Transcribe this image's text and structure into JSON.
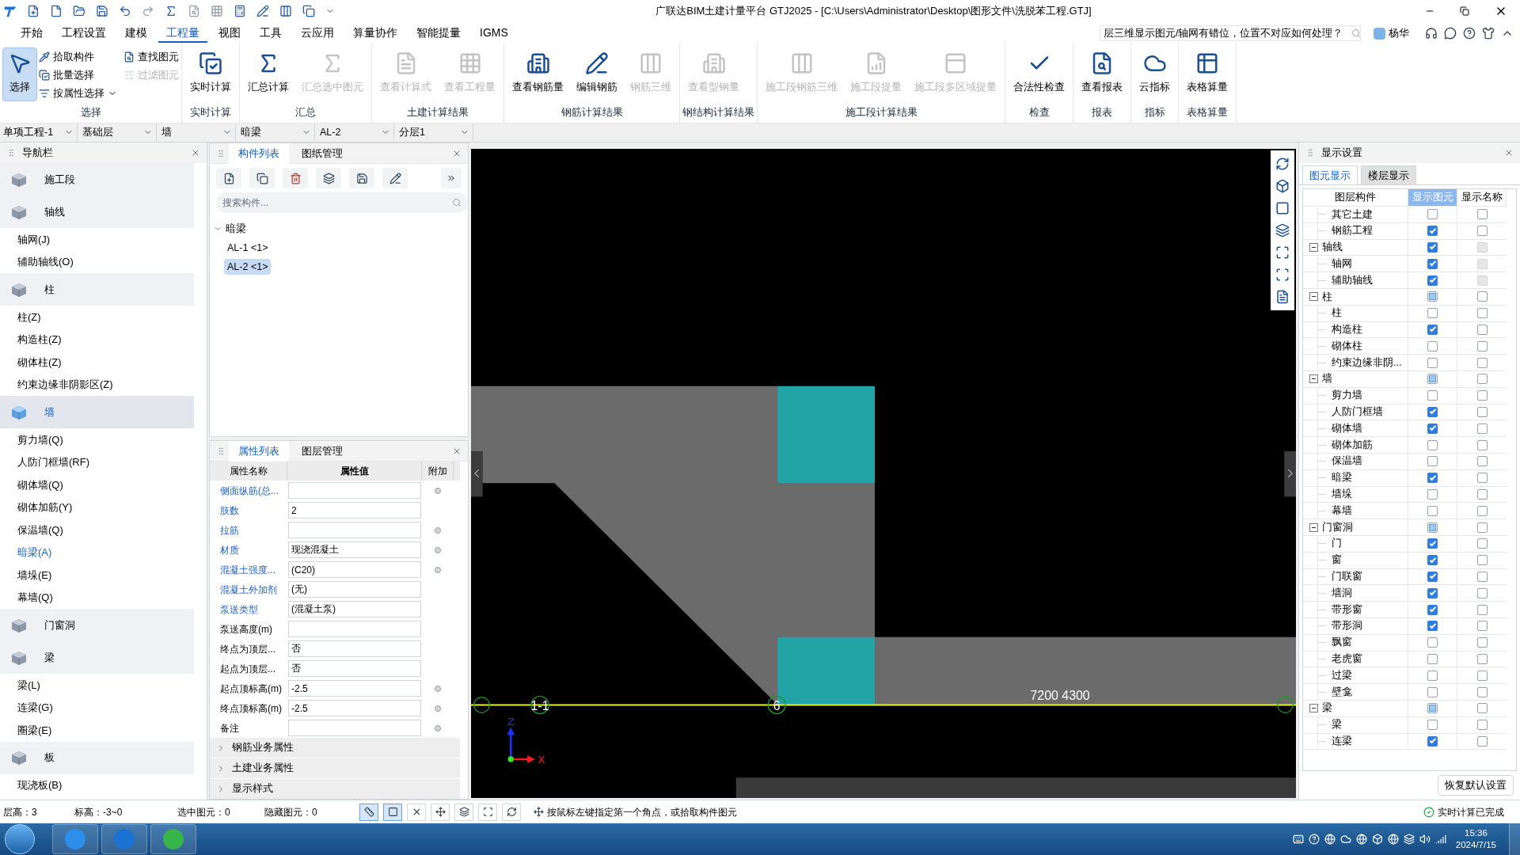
{
  "window": {
    "title": "广联达BIM土建计量平台 GTJ2025 - [C:\\Users\\Administrator\\Desktop\\图形文件\\洗脱苯工程.GTJ]"
  },
  "menu": [
    {
      "label": "开始",
      "selected": false
    },
    {
      "label": "工程设置",
      "selected": false
    },
    {
      "label": "建模",
      "selected": false
    },
    {
      "label": "工程量",
      "selected": true
    },
    {
      "label": "视图",
      "selected": false
    },
    {
      "label": "工具",
      "selected": false
    },
    {
      "label": "云应用",
      "selected": false
    },
    {
      "label": "算量协作",
      "selected": false
    },
    {
      "label": "智能提量",
      "selected": false
    },
    {
      "label": "IGMS",
      "selected": false
    }
  ],
  "help_search": {
    "value": "层三维显示图元/轴网有错位，位置不对应如何处理？"
  },
  "user": {
    "name": "杨华"
  },
  "ribbon": [
    {
      "label": "选择",
      "buttons": [
        {
          "label": "选择",
          "disabled": false,
          "pressed": true
        }
      ],
      "small_buttons": [
        {
          "label": "拾取构件",
          "disabled": false,
          "menu": false
        },
        {
          "label": "批量选择",
          "disabled": false,
          "menu": false
        },
        {
          "label": "按属性选择",
          "disabled": false,
          "menu": true
        },
        {
          "label": "查找图元",
          "disabled": false,
          "menu": false
        },
        {
          "label": "过滤图元",
          "disabled": true,
          "menu": false
        }
      ]
    },
    {
      "label": "实时计算",
      "buttons": [
        {
          "label": "实时计算",
          "disabled": false,
          "pressed": false
        }
      ]
    },
    {
      "label": "汇总",
      "buttons": [
        {
          "label": "汇总计算",
          "disabled": false,
          "pressed": false
        },
        {
          "label": "汇总选中图元",
          "disabled": true,
          "pressed": false
        }
      ]
    },
    {
      "label": "土建计算结果",
      "buttons": [
        {
          "label": "查看计算式",
          "disabled": true,
          "pressed": false
        },
        {
          "label": "查看工程量",
          "disabled": true,
          "pressed": false
        }
      ]
    },
    {
      "label": "钢筋计算结果",
      "buttons": [
        {
          "label": "查看钢筋量",
          "disabled": false,
          "pressed": false
        },
        {
          "label": "编辑钢筋",
          "disabled": false,
          "pressed": false
        },
        {
          "label": "钢筋三维",
          "disabled": true,
          "pressed": false
        }
      ]
    },
    {
      "label": "钢结构计算结果",
      "buttons": [
        {
          "label": "查看型钢量",
          "disabled": true,
          "pressed": false
        }
      ]
    },
    {
      "label": "施工段计算结果",
      "buttons": [
        {
          "label": "施工段钢筋三维",
          "disabled": true,
          "pressed": false
        },
        {
          "label": "施工段提量",
          "disabled": true,
          "pressed": false
        },
        {
          "label": "施工段多区域提量",
          "disabled": true,
          "pressed": false
        }
      ]
    },
    {
      "label": "检查",
      "buttons": [
        {
          "label": "合法性检查",
          "disabled": false,
          "pressed": false
        }
      ]
    },
    {
      "label": "报表",
      "buttons": [
        {
          "label": "查看报表",
          "disabled": false,
          "pressed": false
        }
      ]
    },
    {
      "label": "指标",
      "buttons": [
        {
          "label": "云指标",
          "disabled": false,
          "pressed": false
        }
      ]
    },
    {
      "label": "表格算量",
      "buttons": [
        {
          "label": "表格算量",
          "disabled": false,
          "pressed": false
        }
      ]
    }
  ],
  "selectors": [
    "单项工程-1",
    "基础层",
    "墙",
    "暗梁",
    "AL-2",
    "分层1"
  ],
  "navigation": {
    "title": "导航栏",
    "items": [
      {
        "kind": "category",
        "label": "施工段",
        "selected": false
      },
      {
        "kind": "category",
        "label": "轴线",
        "selected": false
      },
      {
        "kind": "item",
        "label": "轴网(J)",
        "selected": false
      },
      {
        "kind": "item",
        "label": "辅助轴线(O)",
        "selected": false
      },
      {
        "kind": "category",
        "label": "柱",
        "selected": false
      },
      {
        "kind": "item",
        "label": "柱(Z)",
        "selected": false
      },
      {
        "kind": "item",
        "label": "构造柱(Z)",
        "selected": false
      },
      {
        "kind": "item",
        "label": "砌体柱(Z)",
        "selected": false
      },
      {
        "kind": "item",
        "label": "约束边缘非阴影区(Z)",
        "selected": false
      },
      {
        "kind": "category",
        "label": "墙",
        "selected": true
      },
      {
        "kind": "item",
        "label": "剪力墙(Q)",
        "selected": false
      },
      {
        "kind": "item",
        "label": "人防门框墙(RF)",
        "selected": false
      },
      {
        "kind": "item",
        "label": "砌体墙(Q)",
        "selected": false
      },
      {
        "kind": "item",
        "label": "砌体加筋(Y)",
        "selected": false
      },
      {
        "kind": "item",
        "label": "保温墙(Q)",
        "selected": false
      },
      {
        "kind": "item",
        "label": "暗梁(A)",
        "selected": true
      },
      {
        "kind": "item",
        "label": "墙垛(E)",
        "selected": false
      },
      {
        "kind": "item",
        "label": "幕墙(Q)",
        "selected": false
      },
      {
        "kind": "category",
        "label": "门窗洞",
        "selected": false
      },
      {
        "kind": "category",
        "label": "梁",
        "selected": false
      },
      {
        "kind": "item",
        "label": "梁(L)",
        "selected": false
      },
      {
        "kind": "item",
        "label": "连梁(G)",
        "selected": false
      },
      {
        "kind": "item",
        "label": "圈梁(E)",
        "selected": false
      },
      {
        "kind": "category",
        "label": "板",
        "selected": false
      },
      {
        "kind": "item",
        "label": "现浇板(B)",
        "selected": false
      }
    ]
  },
  "component_panel": {
    "tabs": [
      {
        "label": "构件列表",
        "selected": true
      },
      {
        "label": "图纸管理",
        "selected": false
      }
    ],
    "search": {
      "placeholder": "搜索构件..."
    },
    "tree": [
      {
        "label": "暗梁",
        "expanded": true,
        "children": [
          {
            "label": "AL-1 <1>",
            "selected": false
          },
          {
            "label": "AL-2 <1>",
            "selected": true
          }
        ]
      }
    ]
  },
  "property_panel": {
    "tabs": [
      {
        "label": "属性列表",
        "selected": true
      },
      {
        "label": "图层管理",
        "selected": false
      }
    ],
    "columns": [
      "属性名称",
      "属性值",
      "附加"
    ],
    "rows": [
      {
        "name": "侧面纵筋(总...",
        "value": "",
        "public": true,
        "extra": true
      },
      {
        "name": "肢数",
        "value": "2",
        "public": true,
        "extra": false
      },
      {
        "name": "拉筋",
        "value": "",
        "public": true,
        "extra": true
      },
      {
        "name": "材质",
        "value": "现浇混凝土",
        "public": true,
        "extra": true
      },
      {
        "name": "混凝土强度...",
        "value": "(C20)",
        "public": true,
        "extra": true
      },
      {
        "name": "混凝土外加剂",
        "value": "(无)",
        "public": true,
        "extra": false
      },
      {
        "name": "泵送类型",
        "value": "(混凝土泵)",
        "public": true,
        "extra": false
      },
      {
        "name": "泵送高度(m)",
        "value": "",
        "public": false,
        "extra": false
      },
      {
        "name": "终点为顶层...",
        "value": "否",
        "public": false,
        "extra": false
      },
      {
        "name": "起点为顶层...",
        "value": "否",
        "public": false,
        "extra": false
      },
      {
        "name": "起点顶标高(m)",
        "value": "-2.5",
        "public": false,
        "extra": true
      },
      {
        "name": "终点顶标高(m)",
        "value": "-2.5",
        "public": false,
        "extra": true
      },
      {
        "name": "备注",
        "value": "",
        "public": false,
        "extra": true
      }
    ],
    "sections": [
      "钢筋业务属性",
      "土建业务属性",
      "显示样式"
    ]
  },
  "canvas": {
    "axis_labels": [
      "1-1",
      "6",
      "7200 4300"
    ],
    "axis_z": "Z",
    "axis_x": "X"
  },
  "display_settings": {
    "title": "显示设置",
    "tabs": [
      {
        "label": "图元显示",
        "selected": true
      },
      {
        "label": "楼层显示",
        "selected": false
      }
    ],
    "columns": [
      "图层构件",
      "显示图元",
      "显示名称"
    ],
    "groups": [
      {
        "children": [
          {
            "label": "其它土建",
            "show_element": false,
            "show_name": false,
            "name_disabled": false
          },
          {
            "label": "钢筋工程",
            "show_element": true,
            "show_name": false,
            "name_disabled": false
          }
        ]
      },
      {
        "label": "轴线",
        "expanded": true,
        "show_element": true,
        "partial": false,
        "show_name": false,
        "name_disabled": true,
        "children": [
          {
            "label": "轴网",
            "show_element": true,
            "show_name": false,
            "name_disabled": true
          },
          {
            "label": "辅助轴线",
            "show_element": true,
            "show_name": false,
            "name_disabled": true
          }
        ]
      },
      {
        "label": "柱",
        "expanded": true,
        "show_element": false,
        "partial": true,
        "show_name": false,
        "name_disabled": false,
        "children": [
          {
            "label": "柱",
            "show_element": false,
            "show_name": false,
            "name_disabled": false
          },
          {
            "label": "构造柱",
            "show_element": true,
            "show_name": false,
            "name_disabled": false
          },
          {
            "label": "砌体柱",
            "show_element": false,
            "show_name": false,
            "name_disabled": false
          },
          {
            "label": "约束边缘非阴...",
            "show_element": false,
            "show_name": false,
            "name_disabled": false
          }
        ]
      },
      {
        "label": "墙",
        "expanded": true,
        "show_element": false,
        "partial": true,
        "show_name": false,
        "name_disabled": false,
        "children": [
          {
            "label": "剪力墙",
            "show_element": false,
            "show_name": false,
            "name_disabled": false
          },
          {
            "label": "人防门框墙",
            "show_element": true,
            "show_name": false,
            "name_disabled": false
          },
          {
            "label": "砌体墙",
            "show_element": true,
            "show_name": false,
            "name_disabled": false
          },
          {
            "label": "砌体加筋",
            "show_element": false,
            "show_name": false,
            "name_disabled": false
          },
          {
            "label": "保温墙",
            "show_element": false,
            "show_name": false,
            "name_disabled": false
          },
          {
            "label": "暗梁",
            "show_element": true,
            "show_name": false,
            "name_disabled": false
          },
          {
            "label": "墙垛",
            "show_element": false,
            "show_name": false,
            "name_disabled": false
          },
          {
            "label": "幕墙",
            "show_element": false,
            "show_name": false,
            "name_disabled": false
          }
        ]
      },
      {
        "label": "门窗洞",
        "expanded": true,
        "show_element": false,
        "partial": true,
        "show_name": false,
        "name_disabled": false,
        "children": [
          {
            "label": "门",
            "show_element": true,
            "show_name": false,
            "name_disabled": false
          },
          {
            "label": "窗",
            "show_element": true,
            "show_name": false,
            "name_disabled": false
          },
          {
            "label": "门联窗",
            "show_element": true,
            "show_name": false,
            "name_disabled": false
          },
          {
            "label": "墙洞",
            "show_element": true,
            "show_name": false,
            "name_disabled": false
          },
          {
            "label": "带形窗",
            "show_element": true,
            "show_name": false,
            "name_disabled": false
          },
          {
            "label": "带形洞",
            "show_element": true,
            "show_name": false,
            "name_disabled": false
          },
          {
            "label": "飘窗",
            "show_element": false,
            "show_name": false,
            "name_disabled": false
          },
          {
            "label": "老虎窗",
            "show_element": false,
            "show_name": false,
            "name_disabled": false
          },
          {
            "label": "过梁",
            "show_element": false,
            "show_name": false,
            "name_disabled": false
          },
          {
            "label": "壁龛",
            "show_element": false,
            "show_name": false,
            "name_disabled": false
          }
        ]
      },
      {
        "label": "梁",
        "expanded": true,
        "show_element": false,
        "partial": true,
        "show_name": false,
        "name_disabled": false,
        "children": [
          {
            "label": "梁",
            "show_element": false,
            "show_name": false,
            "name_disabled": false
          },
          {
            "label": "连梁",
            "show_element": true,
            "show_name": false,
            "name_disabled": false
          }
        ]
      }
    ],
    "reset_button": "恢复默认设置"
  },
  "status_bar": {
    "fields": [
      "层高：3",
      "标高：-3~0",
      "选中图元：0",
      "隐藏图元：0"
    ],
    "tools": [
      {
        "pressed": true
      },
      {
        "pressed": true
      },
      {
        "pressed": false
      },
      {
        "pressed": false
      },
      {
        "pressed": false
      },
      {
        "pressed": false
      },
      {
        "pressed": false
      }
    ],
    "hint": "按鼠标左键指定第一个角点，或拾取构件图元",
    "status": "实时计算已完成"
  },
  "taskbar": {
    "time": "15:36",
    "date": "2024/7/15"
  }
}
